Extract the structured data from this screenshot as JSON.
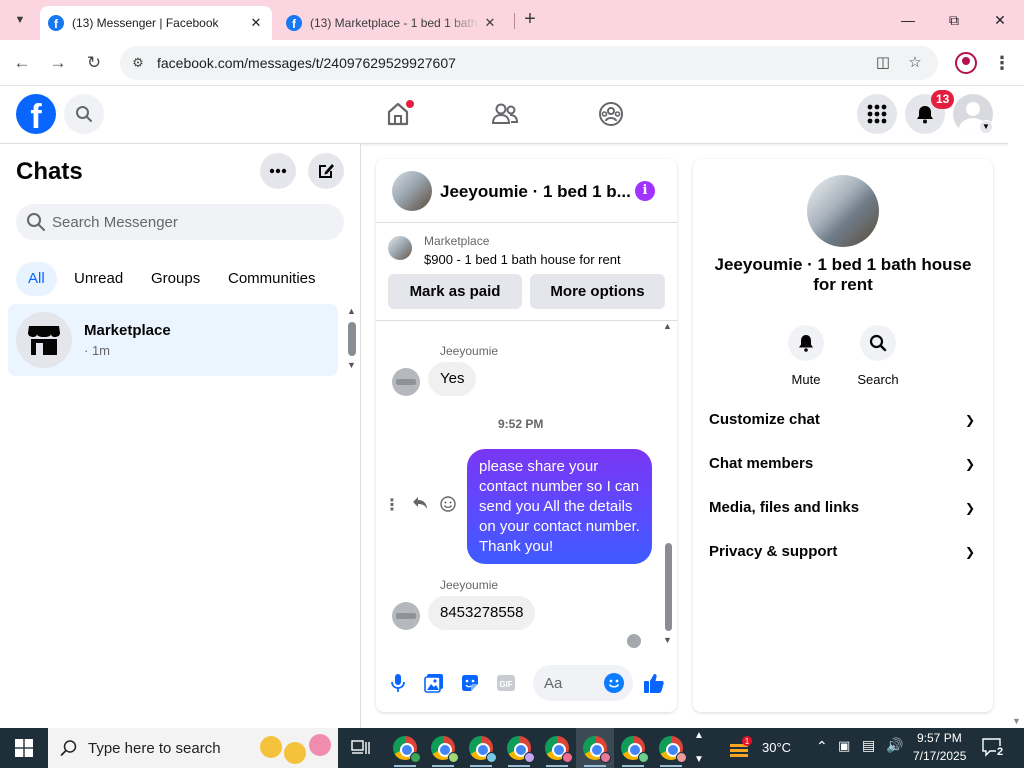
{
  "browser": {
    "tabs": [
      {
        "title": "(13) Messenger | Facebook",
        "active": true
      },
      {
        "title": "(13) Marketplace - 1 bed 1 bath",
        "active": false
      }
    ],
    "url": "facebook.com/messages/t/24097629529927607",
    "icons": {
      "back": "back-arrow-icon",
      "forward": "forward-arrow-icon",
      "reload": "reload-icon",
      "site_info": "tune-icon",
      "install": "install-app-icon",
      "bookmark": "star-icon",
      "profile": "profile-icon",
      "menu": "kebab-menu-icon"
    }
  },
  "facebook": {
    "notification_count": "13",
    "colors": {
      "brand": "#0866ff",
      "badge": "#e41e3f",
      "info": "#a033ff"
    }
  },
  "chats": {
    "title": "Chats",
    "search_placeholder": "Search Messenger",
    "filters": [
      "All",
      "Unread",
      "Groups",
      "Communities"
    ],
    "active_filter": "All",
    "items": [
      {
        "name": "Marketplace",
        "meta": "· 1m"
      }
    ]
  },
  "conversation": {
    "name": "Jeeyoumie · 1 bed 1 b...",
    "marketplace": {
      "label": "Marketplace",
      "listing": "$900 - 1 bed 1 bath house for rent",
      "mark_paid": "Mark as paid",
      "more_options": "More options"
    },
    "messages": [
      {
        "sender": "Jeeyoumie",
        "text": "Yes",
        "direction": "in"
      },
      {
        "timestamp": "9:52 PM"
      },
      {
        "text": "please share your contact number so I can send you All the details on your contact number. Thank you!",
        "direction": "out"
      },
      {
        "sender": "Jeeyoumie",
        "text": "8453278558",
        "direction": "in"
      }
    ],
    "composer_placeholder": "Aa"
  },
  "details": {
    "name": "Jeeyoumie · 1 bed 1 bath house for rent",
    "actions": [
      {
        "label": "Mute",
        "icon": "bell-icon"
      },
      {
        "label": "Search",
        "icon": "search-icon"
      }
    ],
    "sections": [
      "Customize chat",
      "Chat members",
      "Media, files and links",
      "Privacy & support"
    ]
  },
  "taskbar": {
    "search_placeholder": "Type here to search",
    "weather": "30°C",
    "time": "9:57 PM",
    "date": "7/17/2025",
    "notifications": "2"
  }
}
